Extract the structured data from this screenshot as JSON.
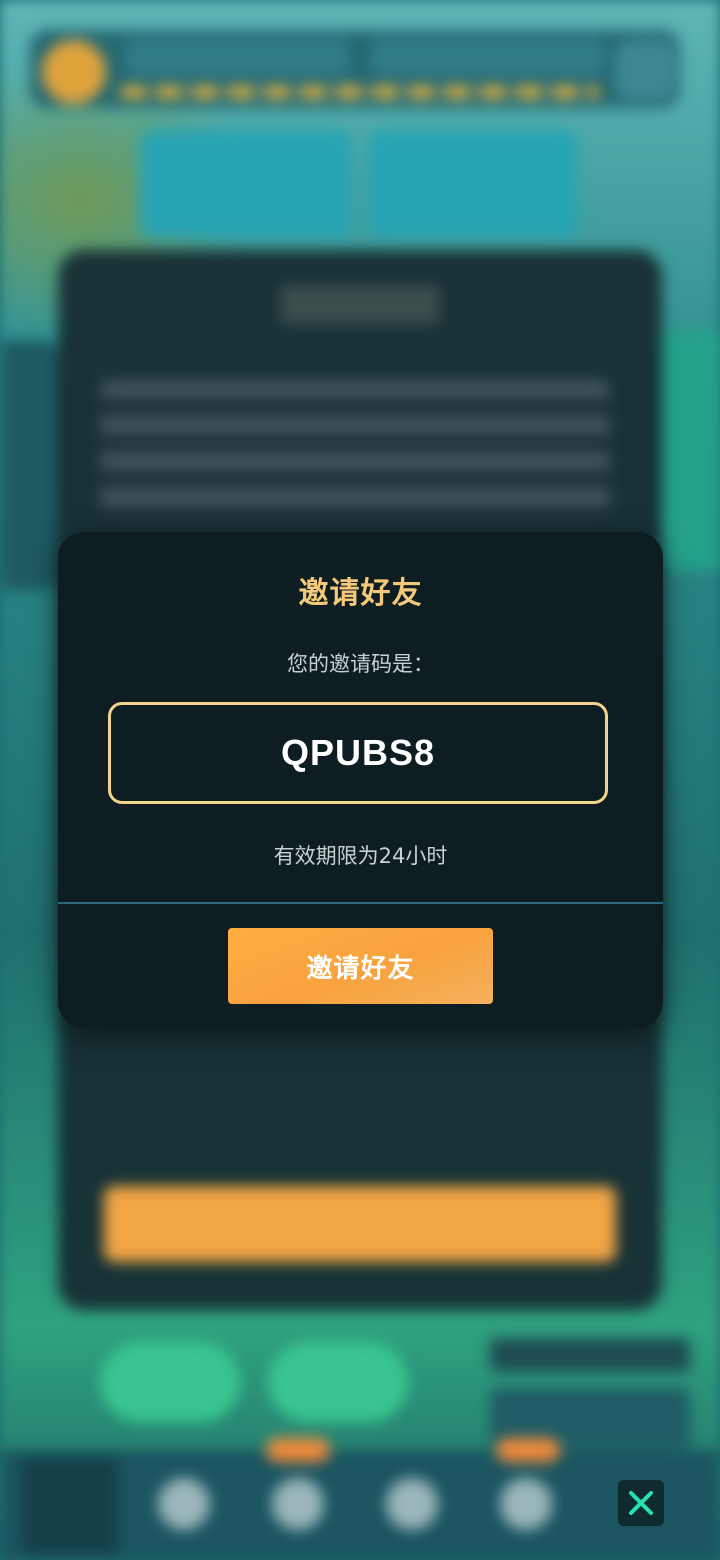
{
  "invite_dialog": {
    "title": "邀请好友",
    "code_label": "您的邀请码是：",
    "invite_code": "QPUBS8",
    "expiry_note": "有效期限为24小时",
    "invite_button_label": "邀请好友"
  },
  "close_button": {
    "icon": "close-icon",
    "color": "#29e0b5"
  },
  "colors": {
    "title_gold": "#f5c97a",
    "code_border": "#f2d38a",
    "button_orange": "#f8a23d",
    "modal_bg": "#0e1d21"
  }
}
